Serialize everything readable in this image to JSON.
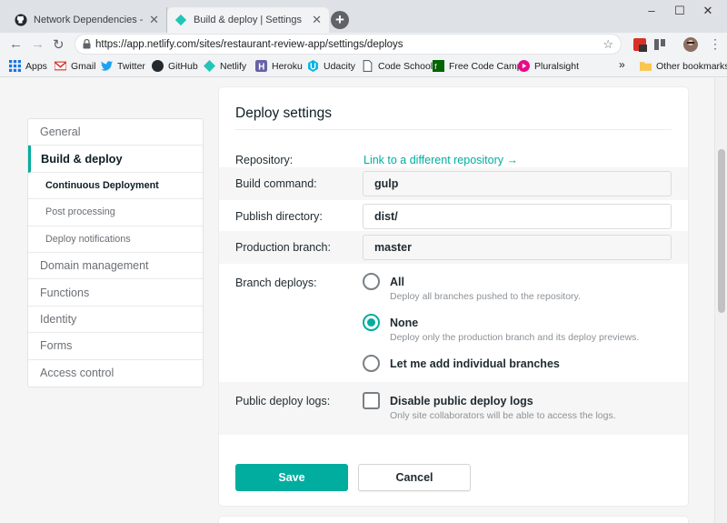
{
  "browser": {
    "tabs": [
      {
        "title": "Network Dependencies - james-p",
        "icon": "github-icon",
        "active": false
      },
      {
        "title": "Build & deploy | Settings",
        "icon": "netlify-icon",
        "active": true
      }
    ],
    "url": "https://app.netlify.com/sites/restaurant-review-app/settings/deploys",
    "window_controls": {
      "minimize": "–",
      "maximize": "☐",
      "close": "✕"
    },
    "bookmarks": [
      {
        "label": "Apps",
        "icon": "apps-grid-icon"
      },
      {
        "label": "Gmail",
        "icon": "gmail-icon"
      },
      {
        "label": "Twitter",
        "icon": "twitter-icon"
      },
      {
        "label": "GitHub",
        "icon": "github-icon"
      },
      {
        "label": "Netlify",
        "icon": "netlify-icon"
      },
      {
        "label": "Heroku",
        "icon": "heroku-icon"
      },
      {
        "label": "Udacity",
        "icon": "udacity-icon"
      },
      {
        "label": "Code School",
        "icon": "page-icon"
      },
      {
        "label": "Free Code Camp",
        "icon": "freecodecamp-icon"
      },
      {
        "label": "Pluralsight",
        "icon": "pluralsight-icon"
      }
    ],
    "overflow": "»",
    "other_bookmarks": "Other bookmarks"
  },
  "sidebar": {
    "items": [
      {
        "label": "General"
      },
      {
        "label": "Build & deploy"
      },
      {
        "label": "Continuous Deployment"
      },
      {
        "label": "Post processing"
      },
      {
        "label": "Deploy notifications"
      },
      {
        "label": "Domain management"
      },
      {
        "label": "Functions"
      },
      {
        "label": "Identity"
      },
      {
        "label": "Forms"
      },
      {
        "label": "Access control"
      }
    ]
  },
  "deploy": {
    "title": "Deploy settings",
    "repository_label": "Repository:",
    "repository_link": "Link to a different repository →",
    "build_command_label": "Build command:",
    "build_command": "gulp",
    "publish_dir_label": "Publish directory:",
    "publish_dir": "dist/",
    "prod_branch_label": "Production branch:",
    "prod_branch": "master",
    "branch_deploys_label": "Branch deploys:",
    "branch_options": [
      {
        "label": "All",
        "help": "Deploy all branches pushed to the repository.",
        "checked": false
      },
      {
        "label": "None",
        "help": "Deploy only the production branch and its deploy previews.",
        "checked": true
      },
      {
        "label": "Let me add individual branches",
        "help": "",
        "checked": false
      }
    ],
    "public_logs_label": "Public deploy logs:",
    "public_logs_option": "Disable public deploy logs",
    "public_logs_help": "Only site collaborators will be able to access the logs.",
    "public_logs_checked": false,
    "save": "Save",
    "cancel": "Cancel"
  },
  "colors": {
    "accent": "#00ad9f",
    "text": "#0e1e25"
  }
}
